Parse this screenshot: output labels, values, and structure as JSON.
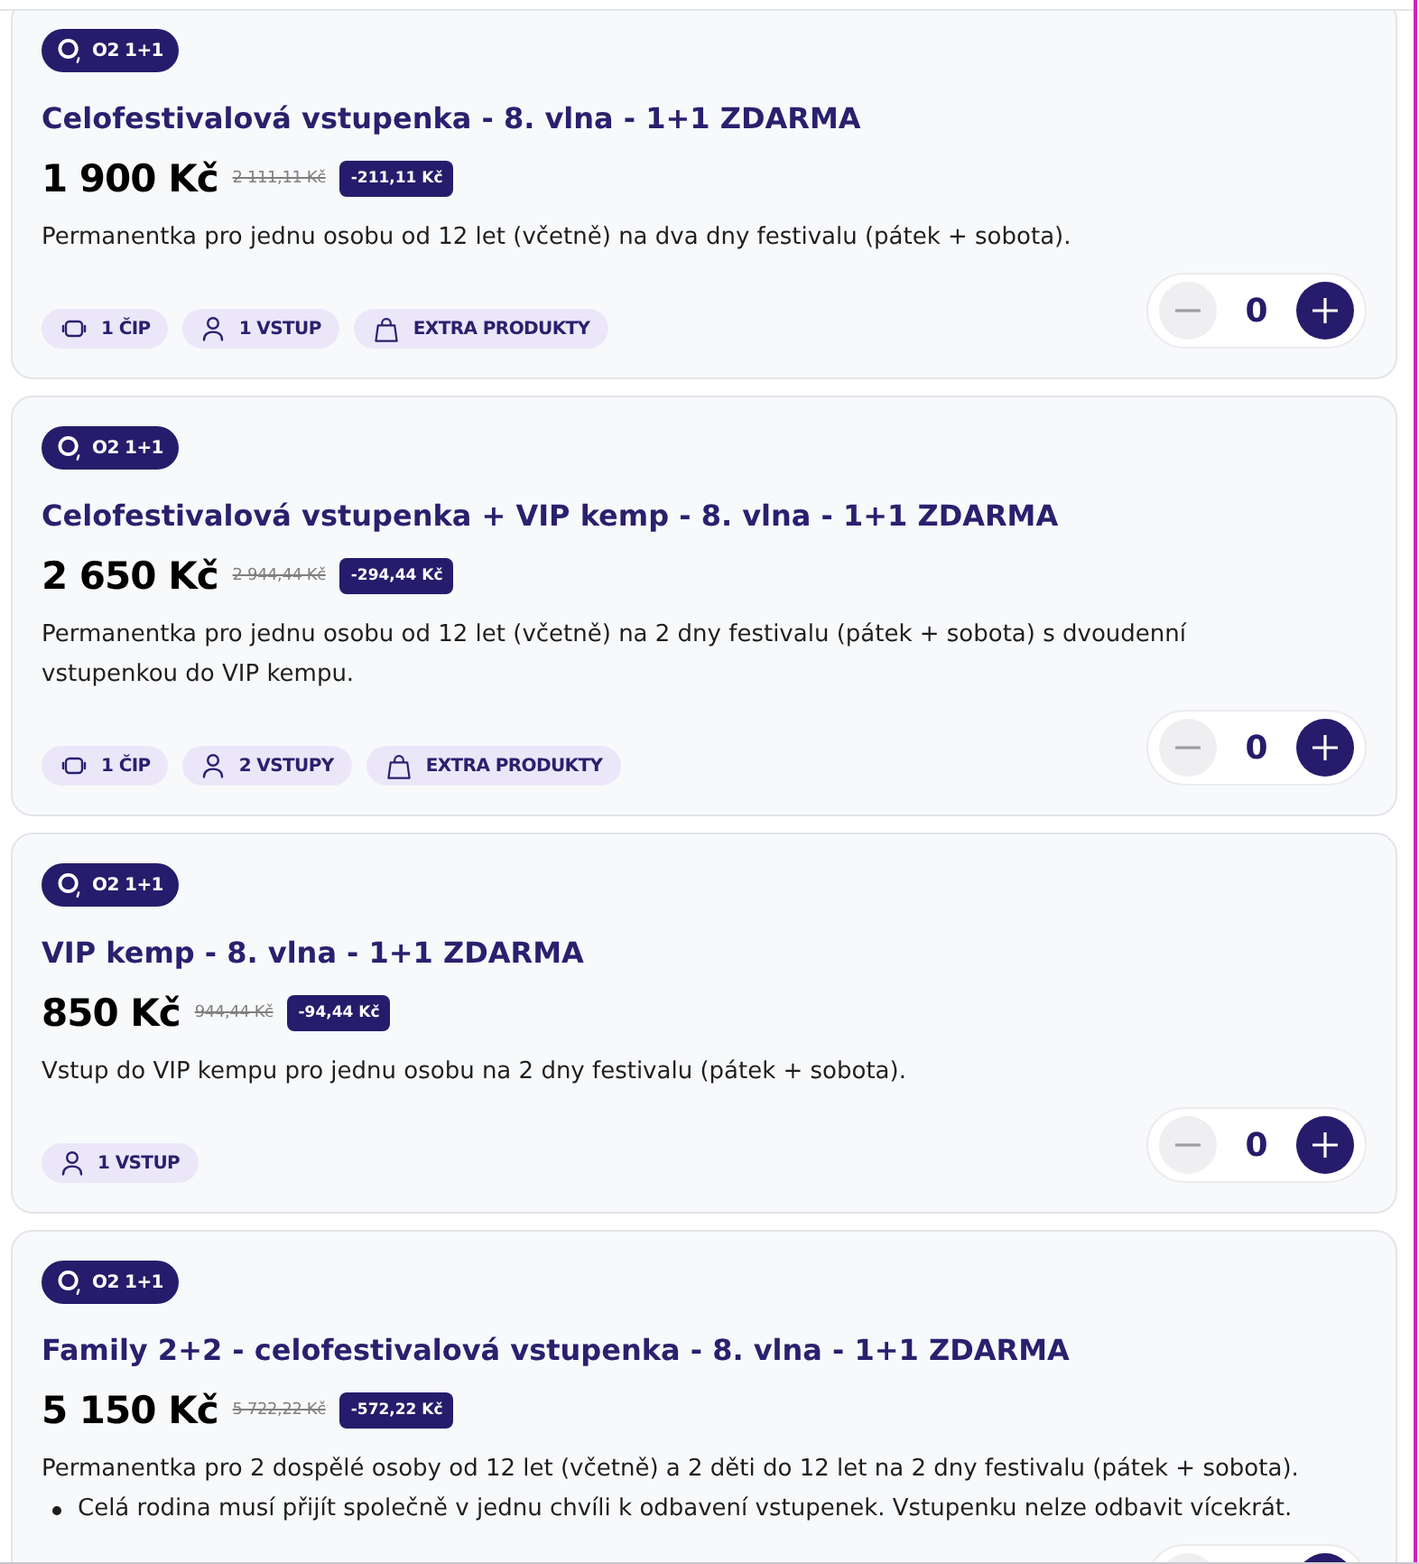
{
  "products": [
    {
      "badge": {
        "label": "O2 1+1"
      },
      "title": "Celofestivalová vstupenka - 8. vlna - 1+1 ZDARMA",
      "price": "1 900 Kč",
      "original_price": "2 111,11 Kč",
      "discount": "-211,11 Kč",
      "description": "Permanentka pro jednu osobu od 12 let (včetně) na dva dny festivalu (pátek + sobota).",
      "tags": [
        {
          "kind": "chip",
          "label": "1 ČIP"
        },
        {
          "kind": "person",
          "label": "1 VSTUP"
        },
        {
          "kind": "bag",
          "label": "EXTRA PRODUKTY"
        }
      ],
      "quantity": "0",
      "decrease_disabled": true
    },
    {
      "badge": {
        "label": "O2 1+1"
      },
      "title": "Celofestivalová vstupenka + VIP kemp - 8. vlna - 1+1 ZDARMA",
      "price": "2 650 Kč",
      "original_price": "2 944,44 Kč",
      "discount": "-294,44 Kč",
      "description": "Permanentka pro jednu osobu od 12 let (včetně) na 2 dny festivalu (pátek + sobota) s dvoudenní vstupenkou do VIP kempu.",
      "tags": [
        {
          "kind": "chip",
          "label": "1 ČIP"
        },
        {
          "kind": "person",
          "label": "2 VSTUPY"
        },
        {
          "kind": "bag",
          "label": "EXTRA PRODUKTY"
        }
      ],
      "quantity": "0",
      "decrease_disabled": true
    },
    {
      "badge": {
        "label": "O2 1+1"
      },
      "title": "VIP kemp - 8. vlna - 1+1 ZDARMA",
      "price": "850 Kč",
      "original_price": "944,44 Kč",
      "discount": "-94,44 Kč",
      "description": "Vstup do VIP kempu pro jednu osobu na 2 dny festivalu (pátek + sobota).",
      "tags": [
        {
          "kind": "person",
          "label": "1 VSTUP"
        }
      ],
      "quantity": "0",
      "decrease_disabled": true
    },
    {
      "badge": {
        "label": "O2 1+1"
      },
      "title": "Family 2+2 - celofestivalová vstupenka - 8. vlna - 1+1 ZDARMA",
      "price": "5 150 Kč",
      "original_price": "5 722,22 Kč",
      "discount": "-572,22 Kč",
      "description": "Permanentka pro 2 dospělé osoby od 12 let (včetně) a 2 děti do 12 let na 2 dny festivalu (pátek + sobota).",
      "bullets": [
        "Celá rodina musí přijít společně v jednu chvíli k odbavení vstupenek. Vstupenku nelze odbavit vícekrát."
      ],
      "decrease_disabled": true
    }
  ]
}
